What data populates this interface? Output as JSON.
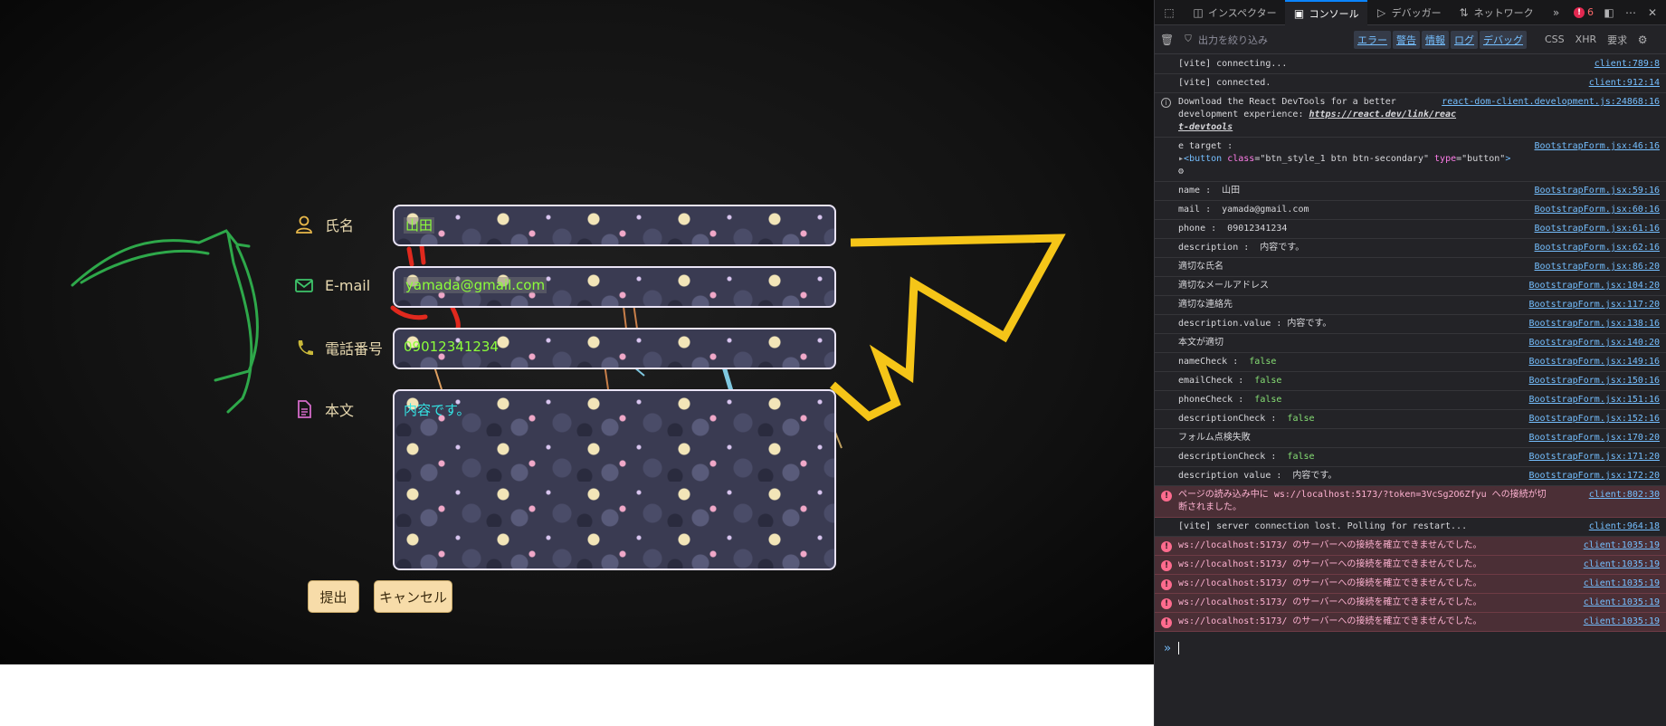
{
  "form": {
    "labels": {
      "name": "氏名",
      "email": "E-mail",
      "phone": "電話番号",
      "description": "本文"
    },
    "values": {
      "name": "山田",
      "email": "yamada@gmail.com",
      "phone": "09012341234",
      "description": "内容です。"
    },
    "buttons": {
      "submit": "提出",
      "cancel": "キャンセル"
    },
    "colors": {
      "label_text": "#e8d9b0",
      "input_text_green": "#8cff3a",
      "textarea_text_cyan": "#33e6e6",
      "button_bg": "#f7dca9",
      "decor_yellow": "#f5c518",
      "decor_green": "#2ea84a"
    },
    "icons": {
      "name": "person-icon",
      "email": "envelope-icon",
      "phone": "phone-icon",
      "description": "document-icon"
    }
  },
  "devtools": {
    "tabs": [
      "インスペクター",
      "コンソール",
      "デバッガー",
      "ネットワーク"
    ],
    "active_tab": "コンソール",
    "error_count": "6",
    "filter_placeholder": "出力を絞り込み",
    "levels": [
      "エラー",
      "警告",
      "情報",
      "ログ",
      "デバッグ"
    ],
    "extra_filters": [
      "CSS",
      "XHR",
      "要求"
    ],
    "logs": [
      {
        "text": "[vite] connecting...",
        "src": "client:789:8",
        "type": "log"
      },
      {
        "text": "[vite] connected.",
        "src": "client:912:14",
        "type": "log"
      },
      {
        "text": "Download the React DevTools for a better\ndevelopment experience: ",
        "link": "https://react.dev/link/react-devtools",
        "link_line1": "https://react.dev/link/reac",
        "link_line2": "t-devtools",
        "src": "react-dom-client.development.js:24868:16",
        "type": "info"
      },
      {
        "text": "e target :",
        "src": "BootstrapForm.jsx:46:16",
        "type": "log",
        "element": {
          "tag": "button",
          "class_attr": "class",
          "class_val": "\"btn_style_1 btn btn-secondary\"",
          "type_attr": "type",
          "type_val": "\"button\""
        }
      },
      {
        "text": "name :  山田",
        "src": "BootstrapForm.jsx:59:16",
        "type": "log"
      },
      {
        "text": "mail :  yamada@gmail.com",
        "src": "BootstrapForm.jsx:60:16",
        "type": "log"
      },
      {
        "text": "phone :  09012341234",
        "src": "BootstrapForm.jsx:61:16",
        "type": "log"
      },
      {
        "text": "description :  内容です。",
        "src": "BootstrapForm.jsx:62:16",
        "type": "log"
      },
      {
        "text": "適切な氏名",
        "src": "BootstrapForm.jsx:86:20",
        "type": "log"
      },
      {
        "text": "適切なメールアドレス",
        "src": "BootstrapForm.jsx:104:20",
        "type": "log"
      },
      {
        "text": "適切な連絡先",
        "src": "BootstrapForm.jsx:117:20",
        "type": "log"
      },
      {
        "text": "description.value : 内容です。",
        "src": "BootstrapForm.jsx:138:16",
        "type": "log"
      },
      {
        "text": "本文が適切",
        "src": "BootstrapForm.jsx:140:20",
        "type": "log"
      },
      {
        "text": "nameCheck :  ",
        "bool": "false",
        "src": "BootstrapForm.jsx:149:16",
        "type": "log"
      },
      {
        "text": "emailCheck :  ",
        "bool": "false",
        "src": "BootstrapForm.jsx:150:16",
        "type": "log"
      },
      {
        "text": "phoneCheck :  ",
        "bool": "false",
        "src": "BootstrapForm.jsx:151:16",
        "type": "log"
      },
      {
        "text": "descriptionCheck :  ",
        "bool": "false",
        "src": "BootstrapForm.jsx:152:16",
        "type": "log"
      },
      {
        "text": "フォルム点検失敗",
        "src": "BootstrapForm.jsx:170:20",
        "type": "log"
      },
      {
        "text": "descriptionCheck :  ",
        "bool": "false",
        "src": "BootstrapForm.jsx:171:20",
        "type": "log"
      },
      {
        "text": "description value :  内容です。",
        "src": "BootstrapForm.jsx:172:20",
        "type": "log"
      },
      {
        "text": "ページの読み込み中に ws://localhost:5173/?token=3VcSg2O6Zfyu への接続が切\n断されました。",
        "src": "client:802:30",
        "type": "error"
      },
      {
        "text": "[vite] server connection lost. Polling for restart...",
        "src": "client:964:18",
        "type": "log"
      },
      {
        "text": "ws://localhost:5173/ のサーバーへの接続を確立できませんでした。",
        "src": "client:1035:19",
        "type": "error"
      },
      {
        "text": "ws://localhost:5173/ のサーバーへの接続を確立できませんでした。",
        "src": "client:1035:19",
        "type": "error"
      },
      {
        "text": "ws://localhost:5173/ のサーバーへの接続を確立できませんでした。",
        "src": "client:1035:19",
        "type": "error"
      },
      {
        "text": "ws://localhost:5173/ のサーバーへの接続を確立できませんでした。",
        "src": "client:1035:19",
        "type": "error"
      },
      {
        "text": "ws://localhost:5173/ のサーバーへの接続を確立できませんでした。",
        "src": "client:1035:19",
        "type": "error"
      }
    ],
    "prompt_symbol": "»"
  }
}
